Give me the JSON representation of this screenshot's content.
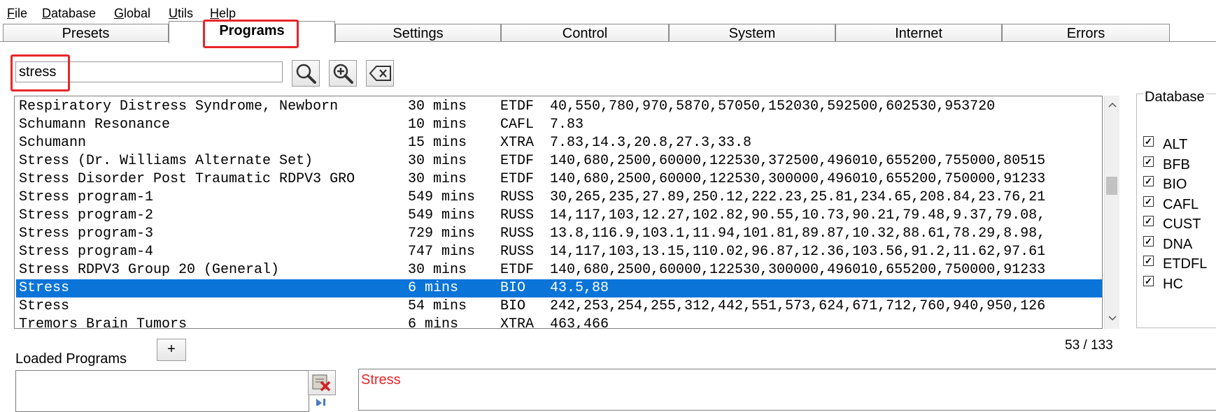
{
  "menu": {
    "items": [
      {
        "label": "File",
        "mnemonic": "F",
        "rest": "ile"
      },
      {
        "label": "Database",
        "mnemonic": "D",
        "rest": "atabase"
      },
      {
        "label": "Global",
        "mnemonic": "G",
        "rest": "lobal"
      },
      {
        "label": "Utils",
        "mnemonic": "U",
        "rest": "tils"
      },
      {
        "label": "Help",
        "mnemonic": "H",
        "rest": "elp"
      }
    ]
  },
  "tabs": {
    "items": [
      "Presets",
      "Programs",
      "Settings",
      "Control",
      "System",
      "Internet",
      "Errors"
    ],
    "active": "Programs"
  },
  "search": {
    "value": "stress"
  },
  "toolbar": {
    "search_icon": "magnifier-icon",
    "zoom_icon": "zoom-in-icon",
    "clear_icon": "backspace-clear-icon"
  },
  "programs": {
    "rows": [
      {
        "name": "Respiratory Distress Syndrome, Newborn",
        "time": "30 mins",
        "db": "ETDF",
        "freqs": "40,550,780,970,5870,57050,152030,592500,602530,953720"
      },
      {
        "name": "Schumann Resonance",
        "time": "10 mins",
        "db": "CAFL",
        "freqs": "7.83"
      },
      {
        "name": "Schumann",
        "time": "15 mins",
        "db": "XTRA",
        "freqs": "7.83,14.3,20.8,27.3,33.8"
      },
      {
        "name": "Stress (Dr. Williams Alternate Set)",
        "time": "30 mins",
        "db": "ETDF",
        "freqs": "140,680,2500,60000,122530,372500,496010,655200,755000,80515"
      },
      {
        "name": "Stress Disorder Post Traumatic RDPV3 GRO",
        "time": "30 mins",
        "db": "ETDF",
        "freqs": "140,680,2500,60000,122530,300000,496010,655200,750000,91233"
      },
      {
        "name": "Stress program-1",
        "time": "549 mins",
        "db": "RUSS",
        "freqs": "30,265,235,27.89,250.12,222.23,25.81,234.65,208.84,23.76,21"
      },
      {
        "name": "Stress program-2",
        "time": "549 mins",
        "db": "RUSS",
        "freqs": "14,117,103,12.27,102.82,90.55,10.73,90.21,79.48,9.37,79.08,"
      },
      {
        "name": "Stress program-3",
        "time": "729 mins",
        "db": "RUSS",
        "freqs": "13.8,116.9,103.1,11.94,101.81,89.87,10.32,88.61,78.29,8.98,"
      },
      {
        "name": "Stress program-4",
        "time": "747 mins",
        "db": "RUSS",
        "freqs": "14,117,103,13.15,110.02,96.87,12.36,103.56,91.2,11.62,97.61"
      },
      {
        "name": "Stress RDPV3 Group 20 (General)",
        "time": "30 mins",
        "db": "ETDF",
        "freqs": "140,680,2500,60000,122530,300000,496010,655200,750000,91233"
      },
      {
        "name": "Stress",
        "time": "6 mins",
        "db": "BIO",
        "freqs": "43.5,88",
        "selected": true
      },
      {
        "name": "Stress",
        "time": "54 mins",
        "db": "BIO",
        "freqs": "242,253,254,255,312,442,551,573,624,671,712,760,940,950,126"
      },
      {
        "name": "Tremors Brain Tumors",
        "time": "6 mins",
        "db": "XTRA",
        "freqs": "463,466"
      }
    ],
    "count": "53 / 133"
  },
  "database_filter": {
    "title": "Database",
    "check_glyph": "✓",
    "items": [
      {
        "label": "ALT",
        "checked": true
      },
      {
        "label": "BFB",
        "checked": true
      },
      {
        "label": "BIO",
        "checked": true
      },
      {
        "label": "CAFL",
        "checked": true
      },
      {
        "label": "CUST",
        "checked": true
      },
      {
        "label": "DNA",
        "checked": true
      },
      {
        "label": "ETDFL",
        "checked": true
      },
      {
        "label": "HC",
        "checked": true
      }
    ]
  },
  "loaded": {
    "label": "Loaded Programs",
    "add_label": "+",
    "detail_title": "Stress"
  },
  "colors": {
    "selection": "#0a74d8",
    "highlight_box": "#e8262a",
    "detail_text": "#e8262a"
  }
}
